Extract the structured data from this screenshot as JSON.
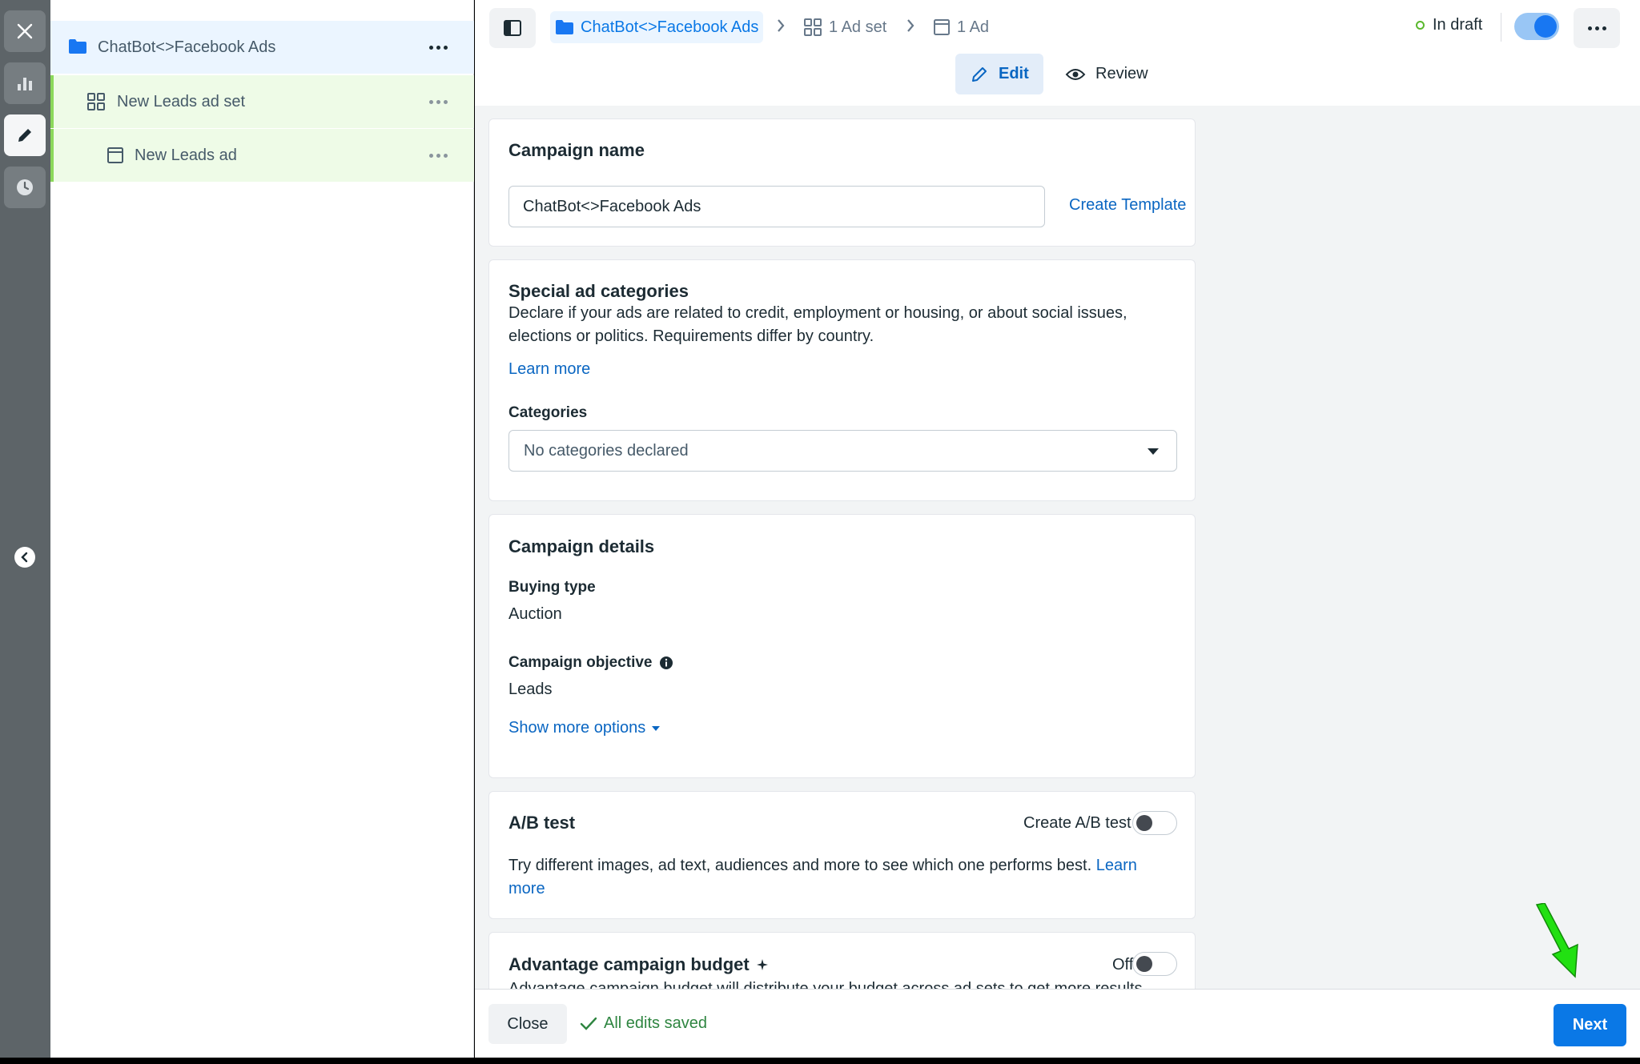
{
  "rail": {
    "icons": [
      "close-icon",
      "chart-icon",
      "pencil-icon",
      "clock-icon",
      "chevron-left-icon"
    ]
  },
  "tree": {
    "campaign": "ChatBot<>Facebook Ads",
    "adset": "New Leads ad set",
    "ad": "New Leads ad"
  },
  "breadcrumb": {
    "campaign": "ChatBot<>Facebook Ads",
    "adset": "1 Ad set",
    "ad": "1 Ad"
  },
  "status": {
    "label": "In draft",
    "toggle_on": true
  },
  "modes": {
    "edit": "Edit",
    "review": "Review"
  },
  "campaign_name": {
    "title": "Campaign name",
    "value": "ChatBot<>Facebook Ads",
    "template_link": "Create Template"
  },
  "special_categories": {
    "title": "Special ad categories",
    "description_line1": "Declare if your ads are related to credit, employment or housing, or about social issues,",
    "description_line2": "elections or politics. Requirements differ by country.",
    "learn_more": "Learn more",
    "categories_label": "Categories",
    "categories_value": "No categories declared"
  },
  "campaign_details": {
    "title": "Campaign details",
    "buying_type_label": "Buying type",
    "buying_type_value": "Auction",
    "objective_label": "Campaign objective",
    "objective_value": "Leads",
    "show_more": "Show more options"
  },
  "ab_test": {
    "title": "A/B test",
    "toggle_label": "Create A/B test",
    "description": "Try different images, ad text, audiences and more to see which one performs best.",
    "learn": "Learn",
    "more": "more"
  },
  "advantage_budget": {
    "title": "Advantage campaign budget",
    "toggle_label": "Off",
    "description": "Advantage campaign budget will distribute your budget across ad sets to get more results"
  },
  "footer": {
    "close": "Close",
    "saved": "All edits saved",
    "next": "Next"
  },
  "colors": {
    "accent": "#0a78e6",
    "saved_green": "#2e8540",
    "arrow_green": "#22e012"
  }
}
